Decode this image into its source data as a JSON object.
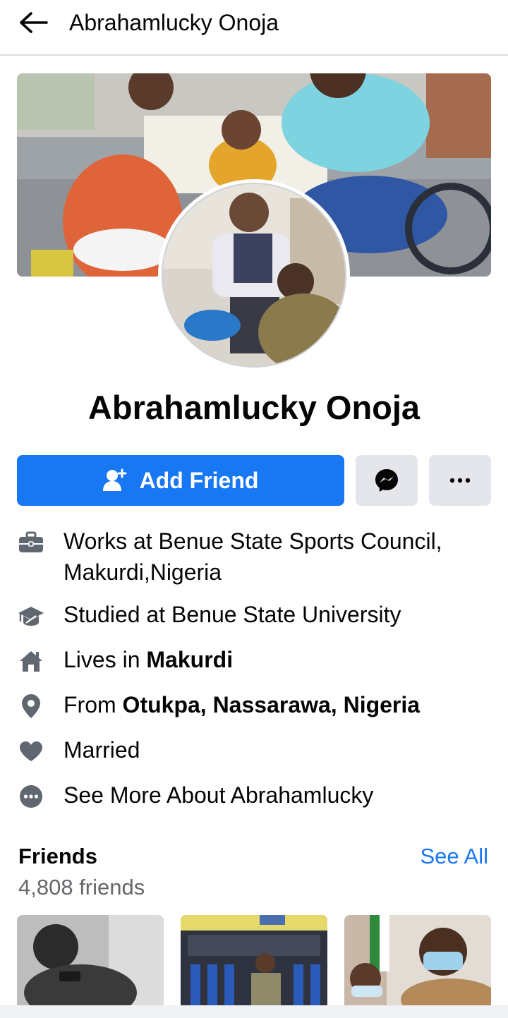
{
  "header": {
    "title": "Abrahamlucky Onoja",
    "back_icon": "arrow-left-icon"
  },
  "profile": {
    "name": "Abrahamlucky Onoja"
  },
  "actions": {
    "add_friend_label": "Add Friend",
    "add_friend_icon": "person-add-icon",
    "messenger_icon": "messenger-icon",
    "more_icon": "more-icon"
  },
  "about": {
    "work_line1": "Works at Benue State Sports Council,",
    "work_line2": "Makurdi,Nigeria",
    "study": "Studied at Benue State University",
    "lives_prefix": "Lives in ",
    "lives_place": "Makurdi",
    "from_prefix": "From ",
    "from_place": "Otukpa, Nassarawa, Nigeria",
    "relationship": "Married",
    "see_more": "See More About Abrahamlucky"
  },
  "friends": {
    "title": "Friends",
    "see_all": "See All",
    "count": "4,808 friends"
  },
  "colors": {
    "accent": "#1877f2",
    "secondary_button": "#e4e6eb",
    "muted_text": "#65676b",
    "icon_gray": "#606770"
  }
}
